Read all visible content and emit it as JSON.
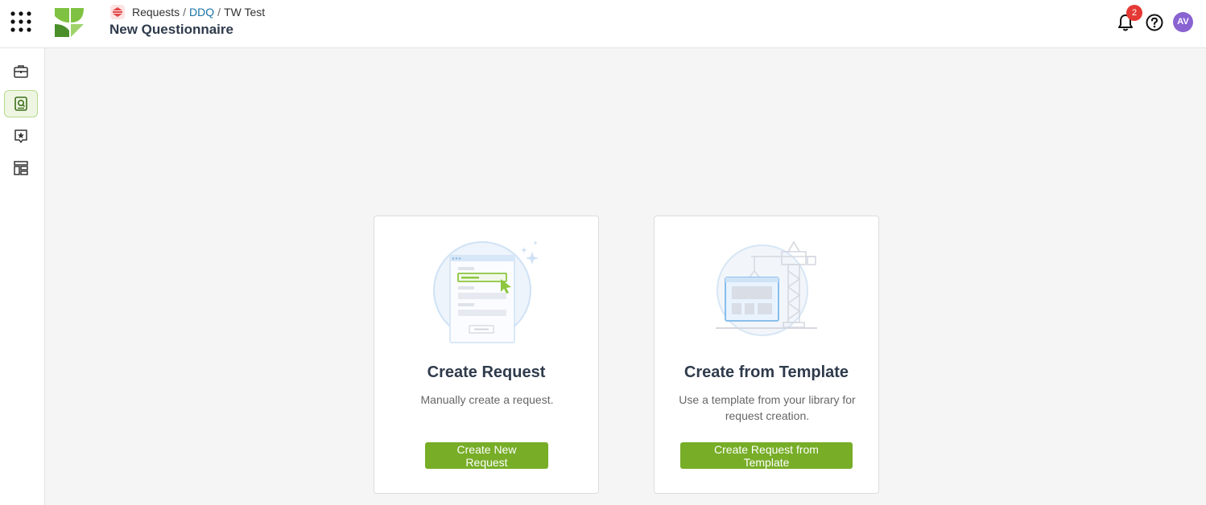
{
  "header": {
    "breadcrumb": {
      "root": "Requests",
      "separator": "/",
      "middle": "DDQ",
      "current": "TW Test"
    },
    "title": "New Questionnaire",
    "notifications_count": "2",
    "avatar_initials": "AV"
  },
  "sidebar": {
    "items": [
      {
        "icon": "briefcase-icon"
      },
      {
        "icon": "search-document-icon",
        "active": true
      },
      {
        "icon": "star-badge-icon"
      },
      {
        "icon": "layout-icon"
      }
    ]
  },
  "cards": [
    {
      "title": "Create Request",
      "description": "Manually create a request.",
      "button_label": "Create New Request"
    },
    {
      "title": "Create from Template",
      "description": "Use a template from your library for request creation.",
      "button_label": "Create Request from Template"
    }
  ],
  "colors": {
    "accent_green": "#77ad27",
    "link_blue": "#1a73a8",
    "badge_red": "#e53935",
    "avatar_purple": "#8a63d2"
  }
}
